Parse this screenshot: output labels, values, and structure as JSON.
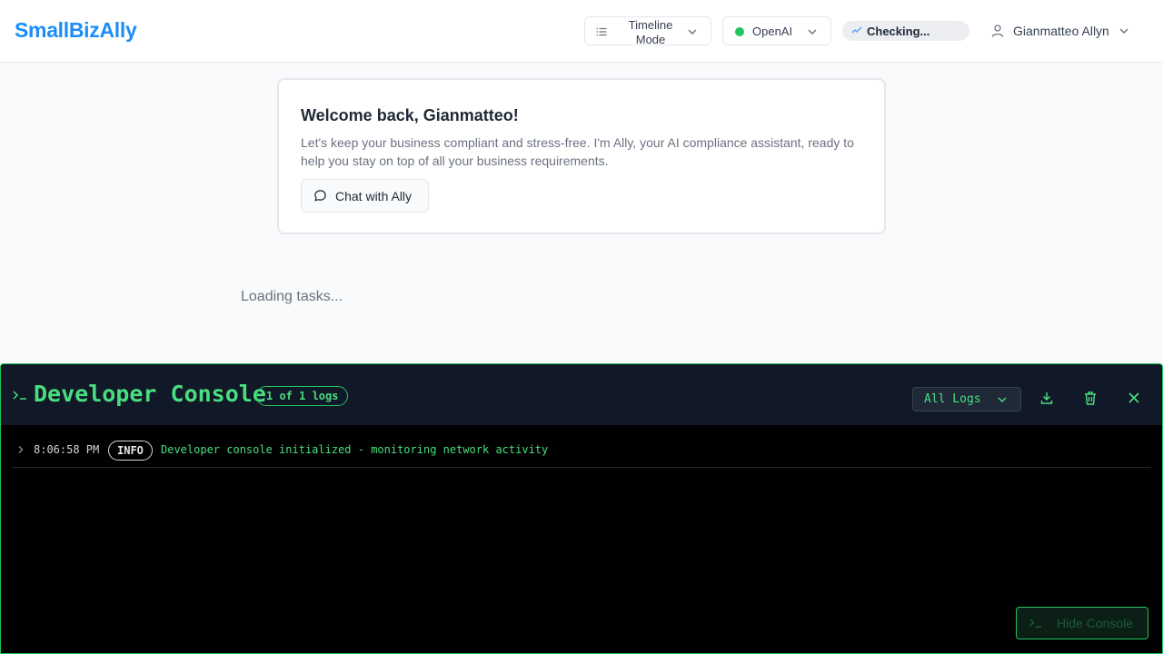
{
  "app": {
    "brand": "SmallBizAlly",
    "accent": "#1d8cf8"
  },
  "header": {
    "view_mode": {
      "label": "Timeline Mode",
      "icon": "list-icon"
    },
    "provider": {
      "label": "OpenAI",
      "status_color": "#22c55e"
    },
    "connection_status": {
      "label": "Checking..."
    },
    "user": {
      "name": "Gianmatteo Allyn",
      "icon": "user-icon"
    }
  },
  "welcome": {
    "title": "Welcome back, Gianmatteo!",
    "message": "Let's keep your business compliant and stress-free. I'm Ally, your AI compliance assistant, ready to help you stay on top of all your business requirements.",
    "chat_button": "Chat with Ally"
  },
  "tasks": {
    "loading_text": "Loading tasks..."
  },
  "console": {
    "title": "Developer Console",
    "log_count": "1 of 1 logs",
    "filter": {
      "selected": "All Logs"
    },
    "logs": [
      {
        "time": "8:06:58 PM",
        "level": "INFO",
        "message": "Developer console initialized - monitoring network activity"
      }
    ],
    "hide_button": "Hide Console",
    "accent": "#4ade80"
  }
}
